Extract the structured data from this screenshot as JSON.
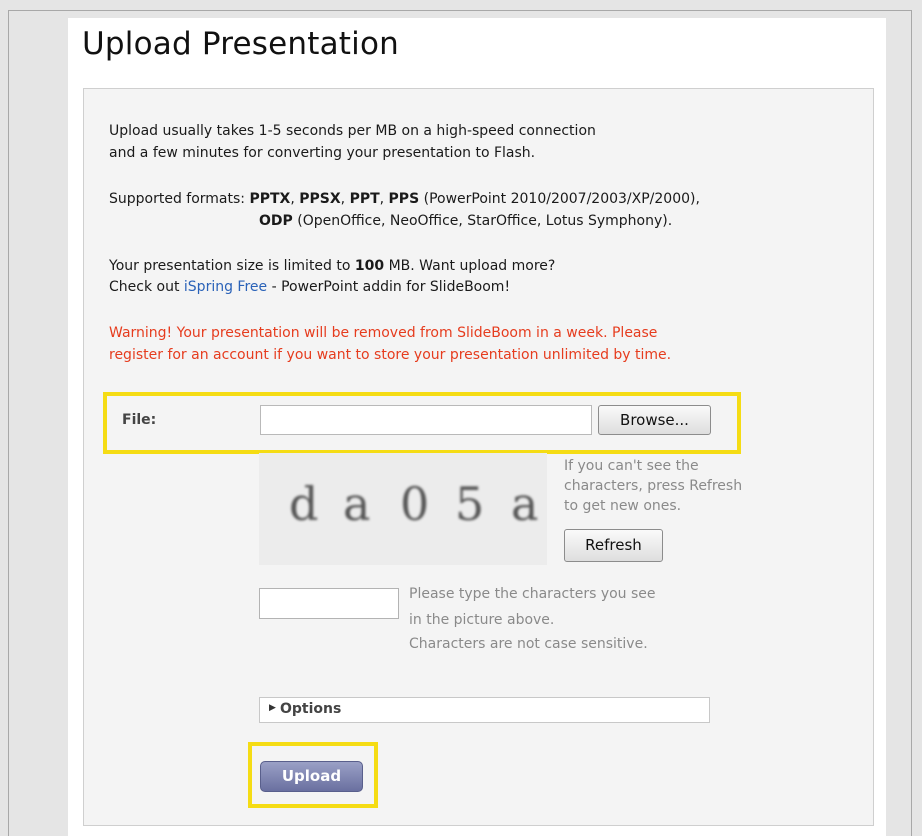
{
  "title": "Upload Presentation",
  "intro": {
    "line1": "Upload usually takes 1-5 seconds per MB on a high-speed connection",
    "line2": "and a few minutes for converting your presentation to Flash."
  },
  "formats": {
    "label": "Supported formats:",
    "f1": "PPTX",
    "f2": "PPSX",
    "f3": "PPT",
    "f4": "PPS",
    "sep": ",",
    "desc1": "(PowerPoint 2010/2007/2003/XP/2000),",
    "f5": "ODP",
    "desc2": "(OpenOffice, NeoOffice, StarOffice, Lotus Symphony)."
  },
  "size": {
    "pre": "Your presentation size is limited to",
    "limit": "100",
    "post": "MB. Want upload more?",
    "check_pre": "Check out",
    "link": "iSpring Free",
    "check_post": "- PowerPoint addin for SlideBoom!"
  },
  "warning": {
    "line1": "Warning! Your presentation will be removed from SlideBoom in a week. Please",
    "line2": "register for an account if you want to store your presentation unlimited by time."
  },
  "file": {
    "label": "File:",
    "value": "",
    "browse_label": "Browse..."
  },
  "captcha": {
    "chars": [
      "d",
      "a",
      "0",
      "5",
      "a"
    ],
    "help1": "If you can't see the",
    "help2": "characters, press Refresh",
    "help3": "to get new ones.",
    "refresh_label": "Refresh",
    "input_value": "",
    "hint1": "Please type the characters you see",
    "hint2": "in the picture above.",
    "hint3": "Characters are not case sensitive."
  },
  "options": {
    "label": "Options",
    "icon": "triangle-right-icon"
  },
  "upload_label": "Upload",
  "colors": {
    "warning": "#e63c1e",
    "link": "#2a62b8",
    "highlight": "#f5dc14",
    "upload_button": "#7a80ae"
  }
}
